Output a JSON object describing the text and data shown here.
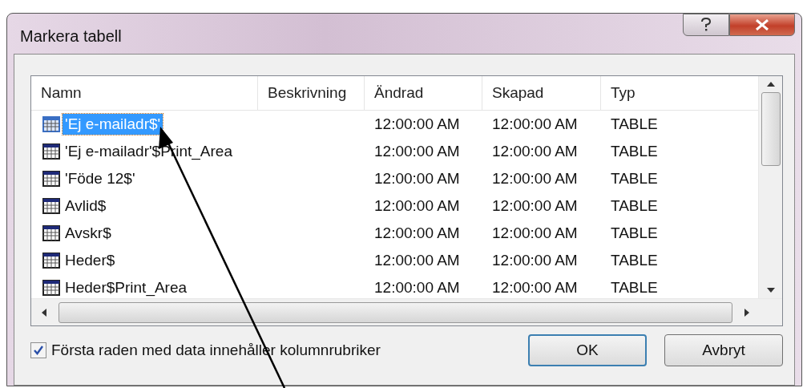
{
  "window": {
    "title": "Markera tabell"
  },
  "table": {
    "columns": [
      "Namn",
      "Beskrivning",
      "Ändrad",
      "Skapad",
      "Typ"
    ],
    "rows": [
      {
        "name": "'Ej e-mailadr$'",
        "description": "",
        "modified": "12:00:00 AM",
        "created": "12:00:00 AM",
        "type": "TABLE",
        "selected": true
      },
      {
        "name": "'Ej e-mailadr'$Print_Area",
        "description": "",
        "modified": "12:00:00 AM",
        "created": "12:00:00 AM",
        "type": "TABLE",
        "selected": false
      },
      {
        "name": "'Föde 12$'",
        "description": "",
        "modified": "12:00:00 AM",
        "created": "12:00:00 AM",
        "type": "TABLE",
        "selected": false
      },
      {
        "name": "Avlid$",
        "description": "",
        "modified": "12:00:00 AM",
        "created": "12:00:00 AM",
        "type": "TABLE",
        "selected": false
      },
      {
        "name": "Avskr$",
        "description": "",
        "modified": "12:00:00 AM",
        "created": "12:00:00 AM",
        "type": "TABLE",
        "selected": false
      },
      {
        "name": "Heder$",
        "description": "",
        "modified": "12:00:00 AM",
        "created": "12:00:00 AM",
        "type": "TABLE",
        "selected": false
      },
      {
        "name": "Heder$Print_Area",
        "description": "",
        "modified": "12:00:00 AM",
        "created": "12:00:00 AM",
        "type": "TABLE",
        "selected": false
      }
    ]
  },
  "header_checkbox": {
    "label": "Första raden med data innehåller kolumnrubriker",
    "checked": true
  },
  "buttons": {
    "ok": "OK",
    "cancel": "Avbryt"
  }
}
